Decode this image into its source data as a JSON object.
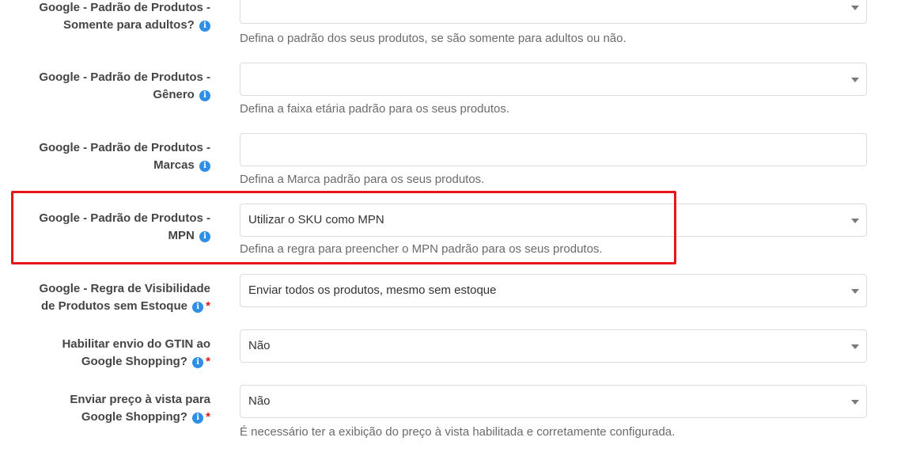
{
  "fields": [
    {
      "label_lines": [
        "Google - Padrão de Produtos -",
        "Somente para adultos?"
      ],
      "value": "",
      "help": "Defina o padrão dos seus produtos, se são somente para adultos ou não."
    },
    {
      "label_lines": [
        "Google - Padrão de Produtos -",
        "Gênero"
      ],
      "value": "",
      "help": "Defina a faixa etária padrão para os seus produtos."
    },
    {
      "label_lines": [
        "Google - Padrão de Produtos -",
        "Marcas"
      ],
      "value": "",
      "help": "Defina a Marca padrão para os seus produtos."
    },
    {
      "label_lines": [
        "Google - Padrão de Produtos -",
        "MPN"
      ],
      "value": "Utilizar o SKU como MPN",
      "help": "Defina a regra para preencher o MPN padrão para os seus produtos."
    },
    {
      "label_lines": [
        "Google - Regra de Visibilidade",
        "de Produtos sem Estoque"
      ],
      "value": "Enviar todos os produtos, mesmo sem estoque",
      "help": ""
    },
    {
      "label_lines": [
        "Habilitar envio do GTIN ao",
        "Google Shopping?"
      ],
      "value": "Não",
      "help": ""
    },
    {
      "label_lines": [
        "Enviar preço à vista para",
        "Google Shopping?"
      ],
      "value": "Não",
      "help": "É necessário ter a exibição do preço à vista habilitada e corretamente configurada."
    }
  ],
  "info_glyph": "i",
  "required_mark": "*",
  "colors": {
    "highlight": "#e8141b",
    "info": "#2f8fe6",
    "required": "#e31818"
  },
  "icons": {
    "info": "info-circle-icon",
    "dropdown": "chevron-down-icon"
  }
}
